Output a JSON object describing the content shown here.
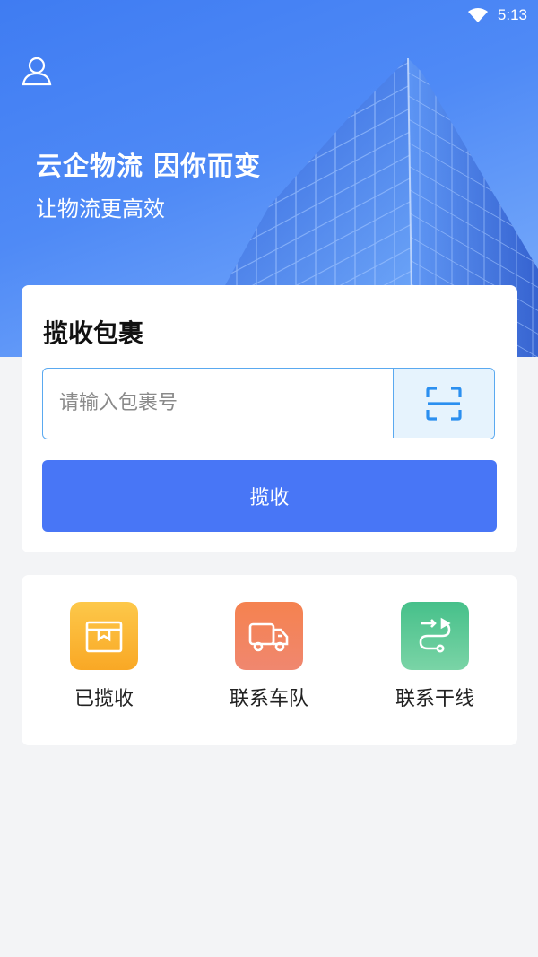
{
  "status_bar": {
    "time": "5:13",
    "wifi_icon": "wifi-icon"
  },
  "header": {
    "user_icon": "user-icon",
    "slogan": "云企物流 因你而变",
    "subslogan": "让物流更高效"
  },
  "collect_card": {
    "title": "揽收包裹",
    "input_placeholder": "请输入包裹号",
    "input_value": "",
    "scan_icon": "scan-icon",
    "button_label": "揽收"
  },
  "actions": [
    {
      "label": "已揽收",
      "icon": "package-icon",
      "color": "#fbb233"
    },
    {
      "label": "联系车队",
      "icon": "truck-icon",
      "color": "#f26b4c"
    },
    {
      "label": "联系干线",
      "icon": "route-icon",
      "color": "#4ec690"
    }
  ],
  "colors": {
    "primary": "#4876f6",
    "hero": "#4a86f4",
    "input_border": "#5aa9f0"
  }
}
